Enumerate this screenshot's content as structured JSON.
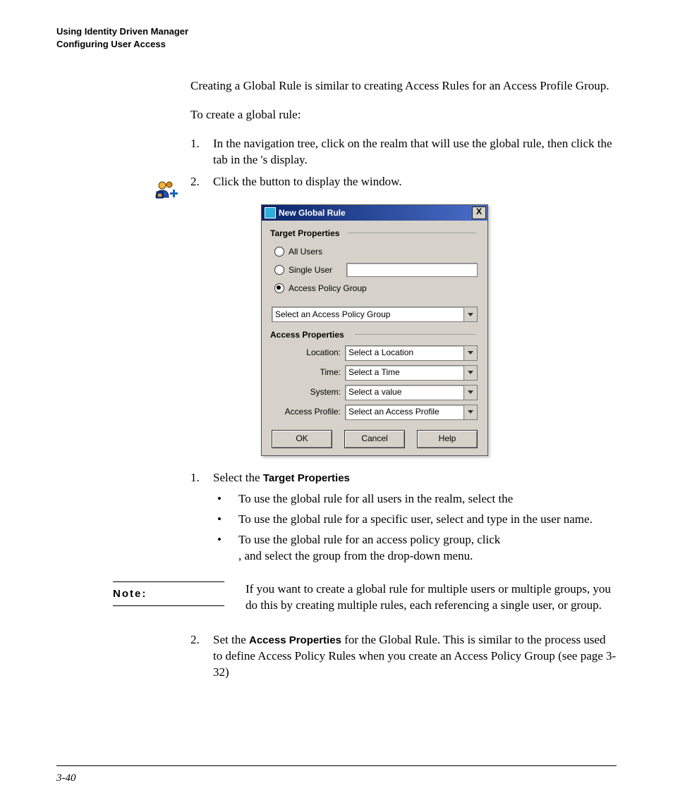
{
  "header": {
    "line1": "Using Identity Driven Manager",
    "line2": "Configuring User Access"
  },
  "intro": {
    "p1": " Creating a Global Rule is similar to creating Access Rules for an Access Profile Group.",
    "p2": "To create a global rule:"
  },
  "steps_top": {
    "s1_num": "1.",
    "s1_a": "In the navigation tree, click on the realm that will use the global rule, then click the ",
    "s1_b": " tab in the ",
    "s1_c": "'s display.",
    "s2_num": "2.",
    "s2_a": "Click the ",
    "s2_b": " button to display the ",
    "s2_c": " window."
  },
  "dialog": {
    "title": "New Global Rule",
    "close": "X",
    "grp_target": "Target Properties",
    "r_all": "All Users",
    "r_single": "Single User",
    "r_apg": "Access Policy Group",
    "dd_apg": "Select an Access Policy Group",
    "grp_access": "Access Properties",
    "rows": {
      "location": {
        "label": "Location:",
        "value": "Select a Location"
      },
      "time": {
        "label": "Time:",
        "value": "Select a Time"
      },
      "system": {
        "label": "System:",
        "value": "Select a value"
      },
      "profile": {
        "label": "Access Profile:",
        "value": "Select an Access Profile"
      }
    },
    "buttons": {
      "ok": "OK",
      "cancel": "Cancel",
      "help": "Help"
    }
  },
  "steps_mid": {
    "s1_num": "1.",
    "s1_a": "Select the ",
    "s1_b": "Target Properties",
    "b1": "To use the global rule for all users in the realm, select the ",
    "b2a": "To use the global rule for a specific user, select ",
    "b2b": " and type in the user name.",
    "b3a": "To use the global rule for an access policy group, click ",
    "b3b": ", and select the group from the drop-down menu."
  },
  "note": {
    "label": "Note:",
    "text": "If you want to create a global rule for multiple users or multiple groups, you do this by creating multiple rules, each referencing a single user, or group."
  },
  "steps_bottom": {
    "s2_num": "2.",
    "s2_a": "Set the ",
    "s2_b": "Access Properties",
    "s2_c": " for the Global Rule. This is similar to the process used to define Access Policy Rules when you create an Access Policy Group (see page 3-32)"
  },
  "page_number": "3-40"
}
